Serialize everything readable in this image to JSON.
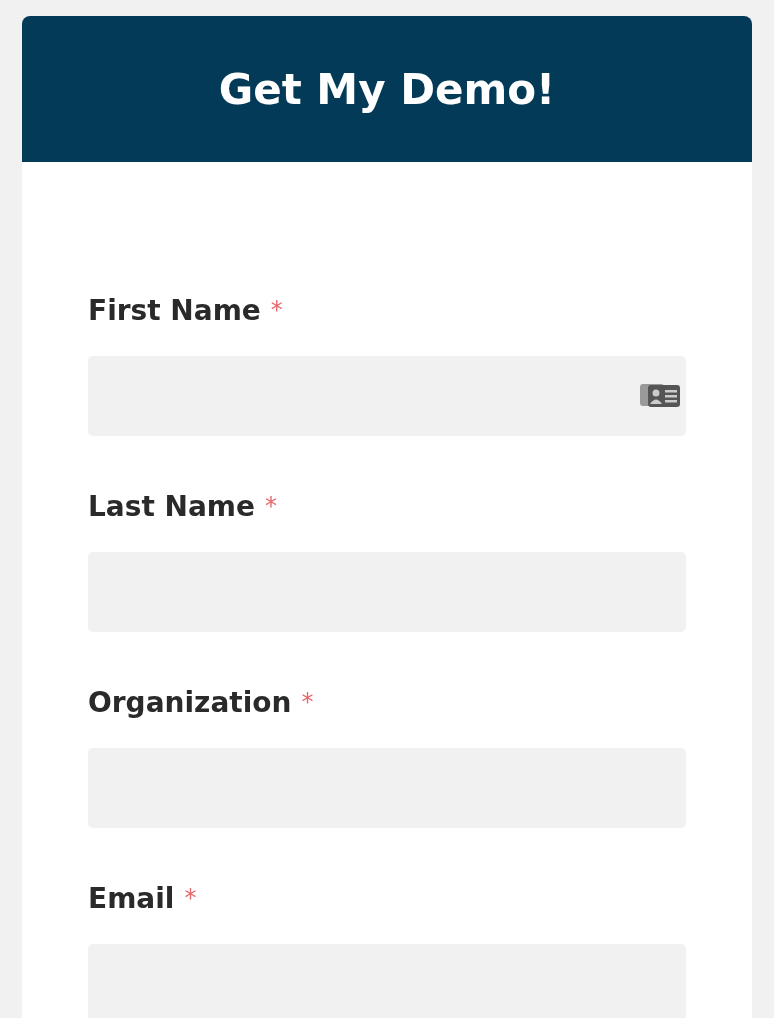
{
  "header": {
    "title": "Get My Demo!"
  },
  "fields": [
    {
      "label": "First Name",
      "required_mark": "*",
      "autofill_icon": true
    },
    {
      "label": "Last Name",
      "required_mark": "*",
      "autofill_icon": false
    },
    {
      "label": "Organization",
      "required_mark": "*",
      "autofill_icon": false
    },
    {
      "label": "Email",
      "required_mark": "*",
      "autofill_icon": false
    }
  ]
}
